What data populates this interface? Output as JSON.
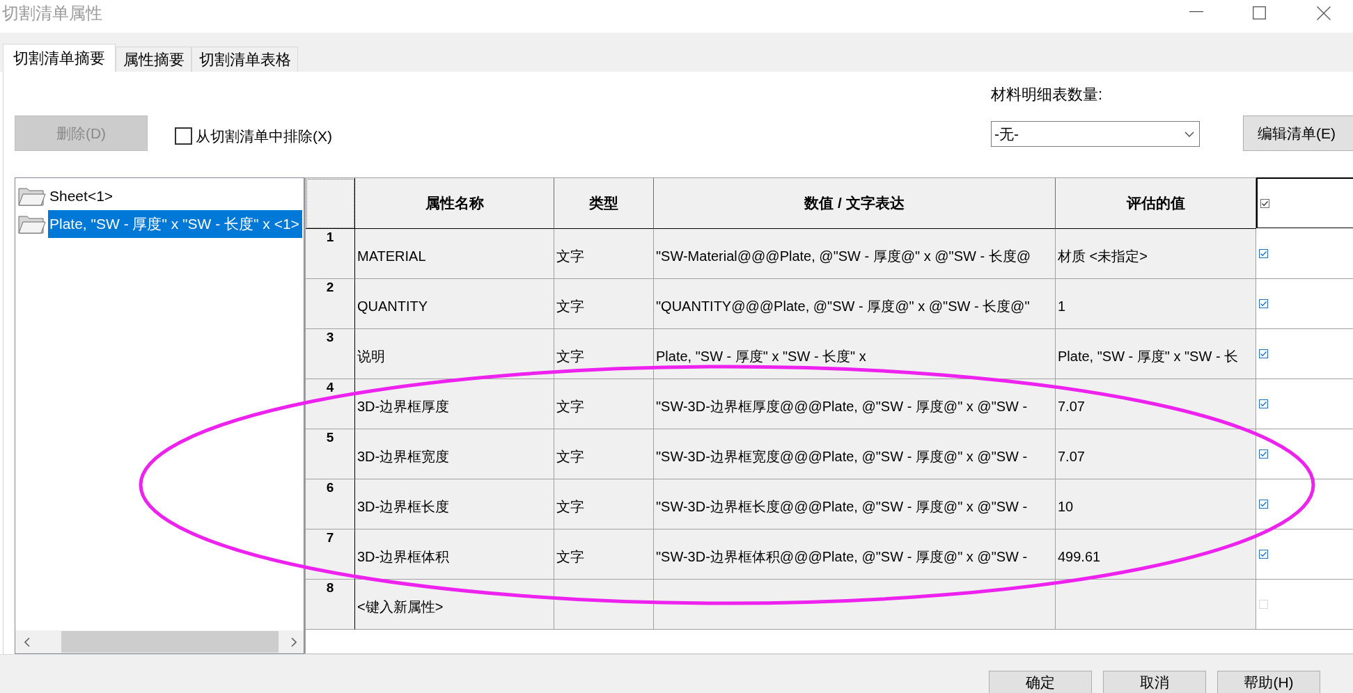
{
  "window": {
    "title": "切割清单属性"
  },
  "tabs": [
    {
      "label": "切割清单摘要",
      "selected": true
    },
    {
      "label": "属性摘要",
      "selected": false
    },
    {
      "label": "切割清单表格",
      "selected": false
    }
  ],
  "toolbar": {
    "delete_button": {
      "label": "删除(D)",
      "disabled": true
    },
    "exclude_checkbox": {
      "label": "从切割清单中排除(X)",
      "checked": false
    },
    "bom_quantity": {
      "label": "材料明细表数量:",
      "value": "-无-"
    },
    "edit_list_button": {
      "label": "编辑清单(E)"
    }
  },
  "tree": {
    "items": [
      {
        "label": "Sheet<1>",
        "selected": false
      },
      {
        "label": "Plate, \"SW - 厚度\" x \"SW - 长度\" x <1>",
        "selected": true
      }
    ]
  },
  "table": {
    "columns": [
      "属性名称",
      "类型",
      "数值 / 文字表达",
      "评估的值"
    ],
    "header_checked": true,
    "rows": [
      {
        "number": "1",
        "name": "MATERIAL",
        "type": "文字",
        "expression": "\"SW-Material@@@Plate, @\"SW - 厚度@\" x @\"SW - 长度@",
        "value": "材质 <未指定>",
        "checked": true,
        "disabled": false
      },
      {
        "number": "2",
        "name": "QUANTITY",
        "type": "文字",
        "expression": "\"QUANTITY@@@Plate, @\"SW - 厚度@\" x @\"SW - 长度@\"",
        "value": "1",
        "checked": true,
        "disabled": false
      },
      {
        "number": "3",
        "name": "说明",
        "type": "文字",
        "expression": "Plate, \"SW - 厚度\" x \"SW - 长度\" x",
        "value": "Plate, \"SW - 厚度\" x \"SW - 长",
        "checked": true,
        "disabled": false
      },
      {
        "number": "4",
        "name": "3D-边界框厚度",
        "type": "文字",
        "expression": "\"SW-3D-边界框厚度@@@Plate, @\"SW - 厚度@\" x @\"SW -",
        "value": "7.07",
        "checked": true,
        "disabled": false
      },
      {
        "number": "5",
        "name": "3D-边界框宽度",
        "type": "文字",
        "expression": "\"SW-3D-边界框宽度@@@Plate, @\"SW - 厚度@\" x @\"SW -",
        "value": "7.07",
        "checked": true,
        "disabled": false
      },
      {
        "number": "6",
        "name": "3D-边界框长度",
        "type": "文字",
        "expression": "\"SW-3D-边界框长度@@@Plate, @\"SW - 厚度@\" x @\"SW -",
        "value": "10",
        "checked": true,
        "disabled": false
      },
      {
        "number": "7",
        "name": "3D-边界框体积",
        "type": "文字",
        "expression": "\"SW-3D-边界框体积@@@Plate, @\"SW - 厚度@\" x @\"SW -",
        "value": "499.61",
        "checked": true,
        "disabled": false
      },
      {
        "number": "8",
        "name": "<键入新属性>",
        "checked": false,
        "disabled": true
      }
    ]
  },
  "highlight": {
    "kind": "ellipse"
  },
  "buttons": [
    {
      "label": "确定"
    },
    {
      "label": "取消"
    },
    {
      "label": "帮助(H)"
    }
  ]
}
